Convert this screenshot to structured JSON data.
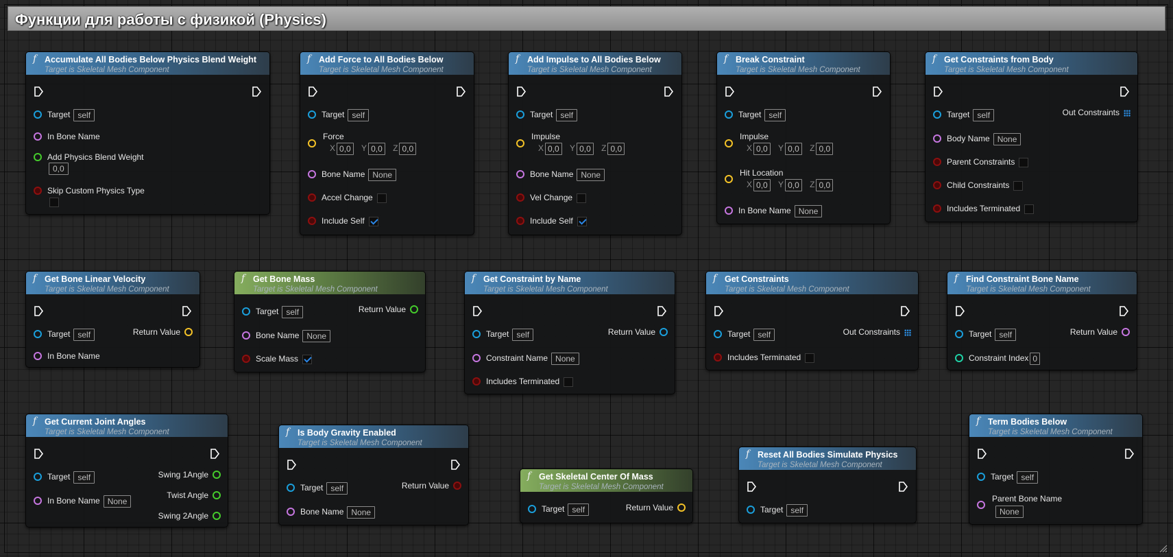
{
  "comment": {
    "title": "Функции для работы с физикой (Physics)"
  },
  "subtitle": "Target is Skeletal Mesh Component",
  "defaults": {
    "self": "self",
    "none": "None",
    "zero_float": "0,0",
    "zero_int": "0"
  },
  "axes": {
    "x": "X",
    "y": "Y",
    "z": "Z"
  },
  "nodes": {
    "accumulate": {
      "title": "Accumulate All Bodies Below Physics Blend Weight",
      "target": "Target",
      "in_bone_name": "In Bone Name",
      "add_weight": "Add Physics Blend Weight",
      "skip_custom": "Skip Custom Physics Type"
    },
    "add_force": {
      "title": "Add Force to All Bodies Below",
      "target": "Target",
      "force": "Force",
      "bone_name": "Bone Name",
      "accel_change": "Accel Change",
      "include_self": "Include Self"
    },
    "add_impulse": {
      "title": "Add Impulse to All Bodies Below",
      "target": "Target",
      "impulse": "Impulse",
      "bone_name": "Bone Name",
      "vel_change": "Vel Change",
      "include_self": "Include Self"
    },
    "break_constraint": {
      "title": "Break Constraint",
      "target": "Target",
      "impulse": "Impulse",
      "hit_location": "Hit Location",
      "in_bone_name": "In Bone Name"
    },
    "get_constraints_from_body": {
      "title": "Get Constraints from Body",
      "target": "Target",
      "body_name": "Body Name",
      "parent_constraints": "Parent Constraints",
      "child_constraints": "Child Constraints",
      "includes_terminated": "Includes Terminated",
      "out_constraints": "Out Constraints"
    },
    "get_bone_linear_velocity": {
      "title": "Get Bone Linear Velocity",
      "target": "Target",
      "in_bone_name": "In Bone Name",
      "return_value": "Return Value"
    },
    "get_bone_mass": {
      "title": "Get Bone Mass",
      "target": "Target",
      "bone_name": "Bone Name",
      "scale_mass": "Scale Mass",
      "return_value": "Return Value"
    },
    "get_constraint_by_name": {
      "title": "Get Constraint by Name",
      "target": "Target",
      "constraint_name": "Constraint Name",
      "includes_terminated": "Includes Terminated",
      "return_value": "Return Value"
    },
    "get_constraints": {
      "title": "Get Constraints",
      "target": "Target",
      "includes_terminated": "Includes Terminated",
      "out_constraints": "Out Constraints"
    },
    "find_constraint_bone_name": {
      "title": "Find Constraint Bone Name",
      "target": "Target",
      "constraint_index": "Constraint Index",
      "return_value": "Return Value"
    },
    "get_current_joint_angles": {
      "title": "Get Current Joint Angles",
      "target": "Target",
      "in_bone_name": "In Bone Name",
      "swing1": "Swing 1Angle",
      "twist": "Twist Angle",
      "swing2": "Swing 2Angle"
    },
    "is_body_gravity_enabled": {
      "title": "Is Body Gravity Enabled",
      "target": "Target",
      "bone_name": "Bone Name",
      "return_value": "Return Value"
    },
    "get_skeletal_center_of_mass": {
      "title": "Get Skeletal Center Of Mass",
      "target": "Target",
      "return_value": "Return Value"
    },
    "reset_all_bodies": {
      "title": "Reset All Bodies Simulate Physics",
      "target": "Target"
    },
    "term_bodies_below": {
      "title": "Term Bodies Below",
      "target": "Target",
      "parent_bone_name": "Parent Bone Name"
    }
  },
  "colors": {
    "object_pin": "#1a9fdc",
    "name_pin": "#c676e0",
    "float_pin": "#45cc2c",
    "vector_pin": "#f4c227",
    "bool_pin": "#8d0f0f",
    "int_pin": "#1fd3a7",
    "function_header": "#4b87b8",
    "pure_header": "#85ad5e"
  },
  "icons": {
    "function": "f",
    "exec_pin": "exec-pin-icon",
    "array_pin": "array-grid-icon"
  }
}
